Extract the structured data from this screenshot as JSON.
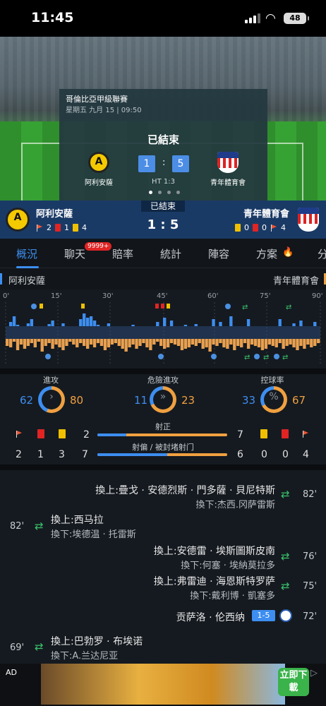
{
  "status_bar": {
    "time": "11:45",
    "battery": "48"
  },
  "match": {
    "league": "哥倫比亞甲級聯賽",
    "datetime": "星期五 九月 15 | 09:50",
    "status": "已結束",
    "home": "阿利安薩",
    "away": "青年體育會",
    "home_score": "1",
    "away_score": "5",
    "halftime": "HT 1:3",
    "score_text": "1 : 5",
    "colon": ":"
  },
  "scorebar": {
    "home_corners": "2",
    "home_red": "1",
    "home_yellow": "4",
    "away_yellow": "0",
    "away_red": "0",
    "away_corners": "4"
  },
  "tabs": [
    "概況",
    "聊天",
    "賠率",
    "統計",
    "陣容",
    "方案",
    "分"
  ],
  "chat_badge": "9999+",
  "timeline": {
    "ticks": [
      "0'",
      "15'",
      "30'",
      "45'",
      "60'",
      "75'",
      "90'"
    ]
  },
  "stats": {
    "attack": {
      "label": "進攻",
      "home": "62",
      "away": "80"
    },
    "dangerous": {
      "label": "危險進攻",
      "home": "11",
      "away": "23"
    },
    "possession": {
      "label": "控球率",
      "home": "33",
      "away": "67"
    },
    "shots_on": {
      "label": "射正",
      "home": "2",
      "away": "7"
    },
    "shots_off": {
      "label": "射偏 / 被封堵射门",
      "home": "7",
      "away": "6"
    },
    "home_counts": {
      "corners": "2",
      "red": "1",
      "yellow": "3"
    },
    "away_counts": {
      "yellow": "0",
      "red": "0",
      "corners": "4"
    }
  },
  "events": [
    {
      "in": "換上:疊戈 · 安德烈斯 · 門多薩 · 貝尼特斯",
      "out": "換下:杰西.冈萨雷斯",
      "minute": "82'"
    },
    {
      "in": "換上:西马拉",
      "out": "換下:埃德温 · 托雷斯",
      "minute": "82'"
    },
    {
      "in": "換上:安德雷 · 埃斯圖斯皮南",
      "out": "換下:何塞 · 埃納莫拉多",
      "minute": "76'"
    },
    {
      "in": "換上:弗雷迪 · 海恩斯特罗萨",
      "out": "換下:戴利博 · 凱塞多",
      "minute": "75'"
    },
    {
      "text": "贡萨洛 · 伦西纳",
      "score": "1-5",
      "minute": "72'"
    },
    {
      "in": "換上:巴勃罗 · 布埃诺",
      "out": "換下:A.兰达尼亚",
      "minute": "69'"
    }
  ],
  "ad": {
    "tag": "AD",
    "button": "立即下載"
  }
}
